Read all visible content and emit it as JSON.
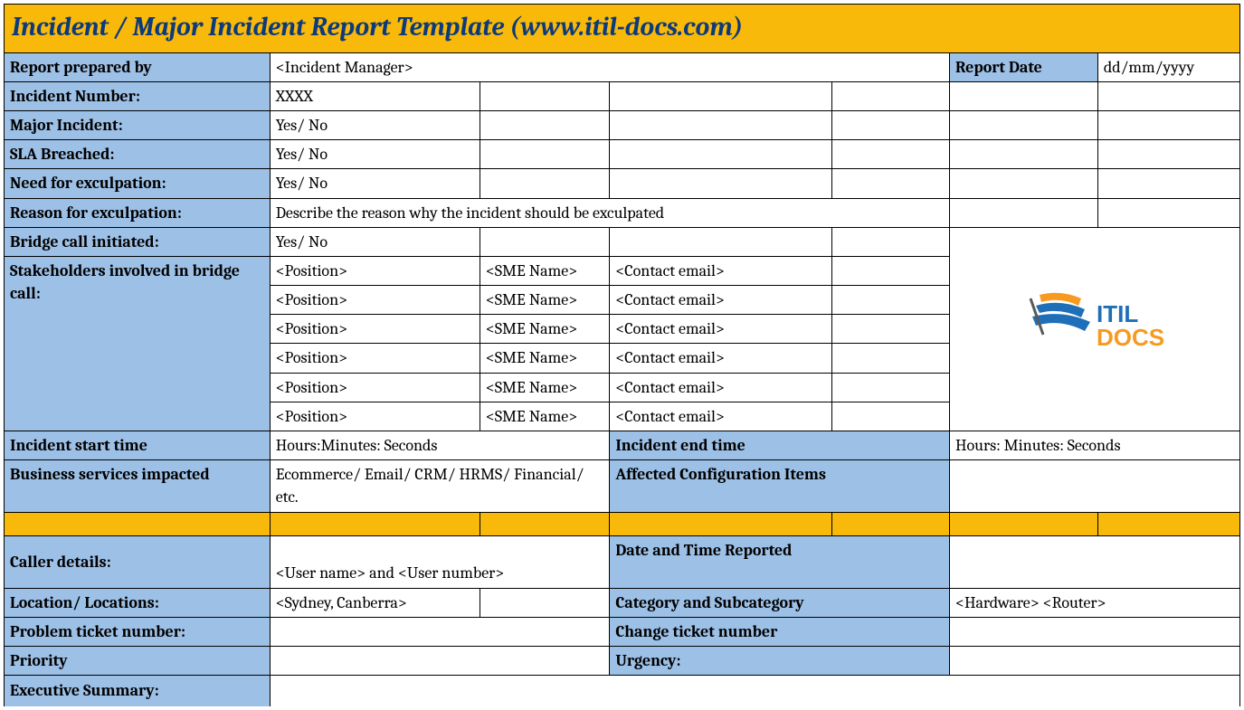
{
  "title": "Incident / Major Incident Report Template   (www.itil-docs.com)",
  "rows": {
    "report_prepared_by": {
      "label": "Report prepared by",
      "value": "<Incident Manager>"
    },
    "report_date": {
      "label": "Report Date",
      "value": "dd/mm/yyyy"
    },
    "incident_number": {
      "label": "Incident Number:",
      "value": "XXXX"
    },
    "major_incident": {
      "label": "Major Incident:",
      "value": "Yes/ No"
    },
    "sla_breached": {
      "label": "SLA Breached:",
      "value": "Yes/ No"
    },
    "need_exculpation": {
      "label": "Need for exculpation:",
      "value": "Yes/ No"
    },
    "reason_exculpation": {
      "label": "Reason for exculpation:",
      "value": "Describe the reason why the incident should be exculpated"
    },
    "bridge_call": {
      "label": "Bridge call initiated:",
      "value": "Yes/ No"
    },
    "stakeholders_label": "Stakeholders involved in bridge call:",
    "stakeholders": [
      {
        "position": "<Position>",
        "sme": "<SME Name>",
        "email": "<Contact email>"
      },
      {
        "position": "<Position>",
        "sme": "<SME Name>",
        "email": "<Contact email>"
      },
      {
        "position": "<Position>",
        "sme": "<SME Name>",
        "email": "<Contact email>"
      },
      {
        "position": "<Position>",
        "sme": "<SME Name>",
        "email": "<Contact email>"
      },
      {
        "position": "<Position>",
        "sme": "<SME Name>",
        "email": "<Contact email>"
      },
      {
        "position": "<Position>",
        "sme": "<SME Name>",
        "email": "<Contact email>"
      }
    ],
    "incident_start": {
      "label": "Incident start time",
      "value": "Hours:Minutes: Seconds"
    },
    "incident_end": {
      "label": "Incident end time",
      "value": "Hours: Minutes: Seconds"
    },
    "business_services": {
      "label": "Business services impacted",
      "value": "Ecommerce/ Email/ CRM/ HRMS/ Financial/ etc."
    },
    "affected_ci": {
      "label": "Affected Configuration Items"
    },
    "caller_details": {
      "label": "Caller details:",
      "value": "<User name> and <User number>"
    },
    "date_time_reported": {
      "label": "Date and Time Reported"
    },
    "location": {
      "label": "Location/ Locations:",
      "value": "<Sydney, Canberra>"
    },
    "category": {
      "label": "Category and Subcategory",
      "value": "<Hardware> <Router>"
    },
    "problem_ticket": {
      "label": "Problem ticket number:"
    },
    "change_ticket": {
      "label": "Change ticket number"
    },
    "priority": {
      "label": "Priority"
    },
    "urgency": {
      "label": "Urgency:"
    },
    "exec_summary": {
      "label": "Executive Summary:"
    }
  },
  "logo": {
    "text_itil": "ITIL",
    "text_docs": "DOCS"
  }
}
